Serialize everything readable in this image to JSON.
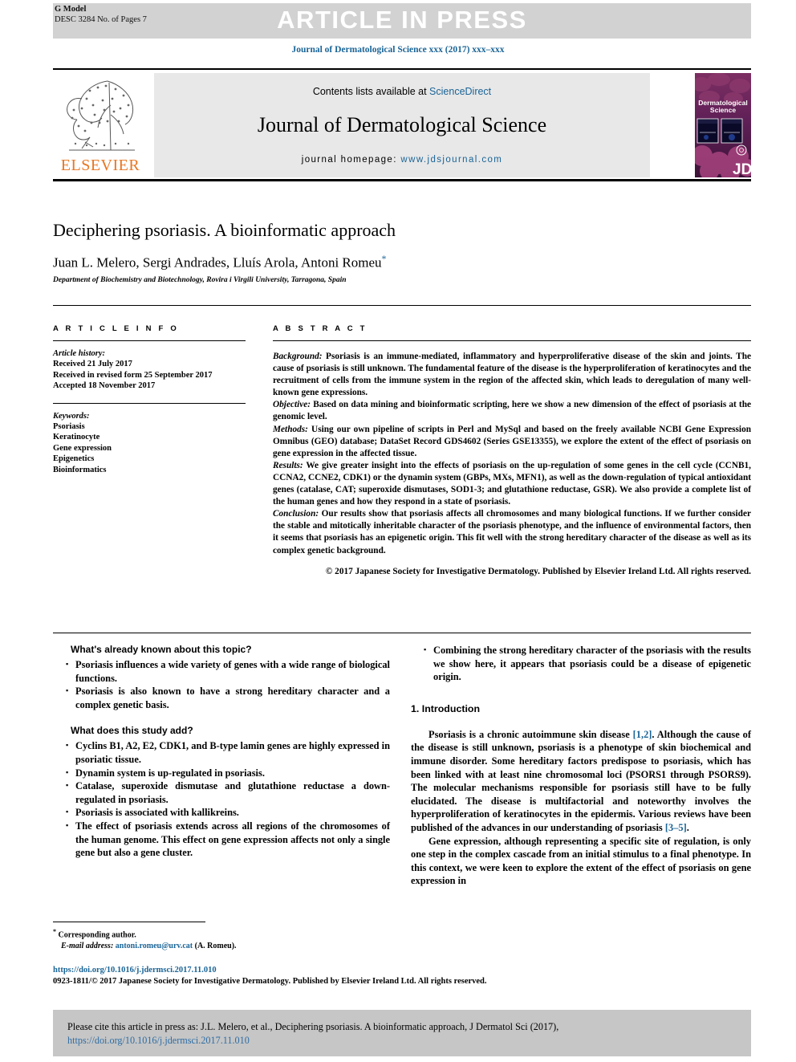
{
  "banner": {
    "article_in_press": "ARTICLE IN PRESS",
    "g_model": "G Model",
    "pages_line": "DESC 3284 No. of Pages 7"
  },
  "journal_citation": "Journal of Dermatological Science xxx (2017) xxx–xxx",
  "masthead": {
    "publisher": "ELSEVIER",
    "contents_prefix": "Contents lists available at ",
    "contents_link": "ScienceDirect",
    "journal_title": "Journal of Dermatological Science",
    "homepage_prefix": "journal homepage: ",
    "homepage_link": "www.jdsjournal.com",
    "cover": {
      "line1": "Dermatological",
      "line2": "Science",
      "logo": "JDS"
    }
  },
  "article": {
    "title": "Deciphering psoriasis. A bioinformatic approach",
    "authors": "Juan L. Melero, Sergi Andrades, Lluís Arola, Antoni Romeu",
    "corresponding_marker": "*",
    "affiliation": "Department of Biochemistry and Biotechnology, Rovira i Virgili University, Tarragona, Spain"
  },
  "article_info": {
    "heading": "A R T I C L E   I N F O",
    "history_label": "Article history:",
    "history": [
      "Received 21 July 2017",
      "Received in revised form 25 September 2017",
      "Accepted 18 November 2017"
    ],
    "keywords_label": "Keywords:",
    "keywords": [
      "Psoriasis",
      "Keratinocyte",
      "Gene expression",
      "Epigenetics",
      "Bioinformatics"
    ]
  },
  "abstract": {
    "heading": "A B S T R A C T",
    "sections": [
      {
        "label": "Background:",
        "text": " Psoriasis is an immune-mediated, inflammatory and hyperproliferative disease of the skin and joints. The cause of psoriasis is still unknown. The fundamental feature of the disease is the hyperproliferation of keratinocytes and the recruitment of cells from the immune system in the region of the affected skin, which leads to deregulation of many well-known gene expressions."
      },
      {
        "label": "Objective:",
        "text": " Based on data mining and bioinformatic scripting, here we show a new dimension of the effect of psoriasis at the genomic level."
      },
      {
        "label": "Methods:",
        "text": " Using our own pipeline of scripts in Perl and MySql and based on the freely available NCBI Gene Expression Omnibus (GEO) database; DataSet Record GDS4602 (Series GSE13355), we explore the extent of the effect of psoriasis on gene expression in the affected tissue."
      },
      {
        "label": "Results:",
        "text": " We give greater insight into the effects of psoriasis on the up-regulation of some genes in the cell cycle (CCNB1, CCNA2, CCNE2, CDK1) or the dynamin system (GBPs, MXs, MFN1), as well as the down-regulation of typical antioxidant genes (catalase, CAT; superoxide dismutases, SOD1-3; and glutathione reductase, GSR). We also provide a complete list of the human genes and how they respond in a state of psoriasis."
      },
      {
        "label": "Conclusion:",
        "text": " Our results show that psoriasis affects all chromosomes and many biological functions. If we further consider the stable and mitotically inheritable character of the psoriasis phenotype, and the influence of environmental factors, then it seems that psoriasis has an epigenetic origin. This fit well with the strong hereditary character of the disease as well as its complex genetic background."
      }
    ],
    "copyright": "© 2017 Japanese Society for Investigative Dermatology. Published by Elsevier Ireland Ltd. All rights reserved."
  },
  "highlights": {
    "known_title": "What's already known about this topic?",
    "known_items": [
      "Psoriasis influences a wide variety of genes with a wide range of biological functions.",
      "Psoriasis is also known to have a strong hereditary character and a complex genetic basis."
    ],
    "adds_title": "What does this study add?",
    "adds_items": [
      "Cyclins B1, A2, E2, CDK1, and B-type lamin genes are highly expressed in psoriatic tissue.",
      "Dynamin system is up-regulated in psoriasis.",
      "Catalase, superoxide dismutase and glutathione reductase a down-regulated in psoriasis.",
      "Psoriasis is associated with kallikreins.",
      "The effect of psoriasis extends across all regions of the chromosomes of the human genome. This effect on gene expression affects not only a single gene but also a gene cluster."
    ],
    "right_items": [
      "Combining the strong hereditary character of the psoriasis with the results we show here, it appears that psoriasis could be a disease of epigenetic origin."
    ]
  },
  "introduction": {
    "heading": "1. Introduction",
    "paragraph1_a": "Psoriasis is a chronic autoimmune skin disease ",
    "paragraph1_ref1": "[1,2]",
    "paragraph1_b": ". Although the cause of the disease is still unknown, psoriasis is a phenotype of skin biochemical and immune disorder. Some hereditary factors predispose to psoriasis, which has been linked with at least nine chromosomal loci (PSORS1 through PSORS9). The molecular mechanisms responsible for psoriasis still have to be fully elucidated. The disease is multifactorial and noteworthy involves the hyperproliferation of keratinocytes in the epidermis. Various reviews have been published of the advances in our understanding of psoriasis ",
    "paragraph1_ref2": "[3–5]",
    "paragraph1_c": ".",
    "paragraph2": "Gene expression, although representing a specific site of regulation, is only one step in the complex cascade from an initial stimulus to a final phenotype. In this context, we were keen to explore the extent of the effect of psoriasis on gene expression in"
  },
  "footnote": {
    "corresponding": "Corresponding author.",
    "email_label": "E-mail address:",
    "email": "antoni.romeu@urv.cat",
    "email_suffix": " (A. Romeu)."
  },
  "doi_block": {
    "doi": "https://doi.org/10.1016/j.jdermsci.2017.11.010",
    "issn_copyright": "0923-1811/© 2017 Japanese Society for Investigative Dermatology. Published by Elsevier Ireland Ltd. All rights reserved."
  },
  "cite_box": {
    "text": "Please cite this article in press as: J.L. Melero, et al., Deciphering psoriasis. A bioinformatic approach, J Dermatol Sci (2017), ",
    "doi": "https://doi.org/10.1016/j.jdermsci.2017.11.010"
  },
  "colors": {
    "link_blue": "#1a6496",
    "elsevier_orange": "#e87722",
    "banner_gray": "#d2d2d2",
    "masthead_gray": "#e8e8e8",
    "cite_gray": "#c6c6c6",
    "cover_purple": "#6b2a6b"
  }
}
